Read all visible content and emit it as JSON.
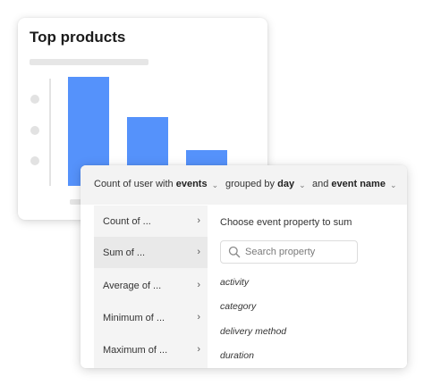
{
  "card": {
    "title": "Top products",
    "chart_data": {
      "type": "bar",
      "categories": [
        "",
        "",
        ""
      ],
      "values": [
        100,
        63,
        33
      ],
      "title": "Top products",
      "ylim": [
        0,
        100
      ],
      "bar_color": "#5592fb"
    }
  },
  "toolbar": {
    "measure_prefix": "Count of user with ",
    "measure_value": "events",
    "group_prefix": "grouped by ",
    "group_value": "day",
    "filter_prefix": "and ",
    "filter_value": "event name"
  },
  "aggregations": [
    {
      "label": "Count of ..."
    },
    {
      "label": "Sum of ..."
    },
    {
      "label": "Average of ..."
    },
    {
      "label": "Minimum of ..."
    },
    {
      "label": "Maximum of ..."
    }
  ],
  "property_panel": {
    "title": "Choose event property to sum",
    "search_placeholder": "Search property",
    "properties": [
      "activity",
      "category",
      "delivery method",
      "duration"
    ]
  },
  "colors": {
    "accent": "#5592fb",
    "active_row": "#e9e9e9"
  }
}
